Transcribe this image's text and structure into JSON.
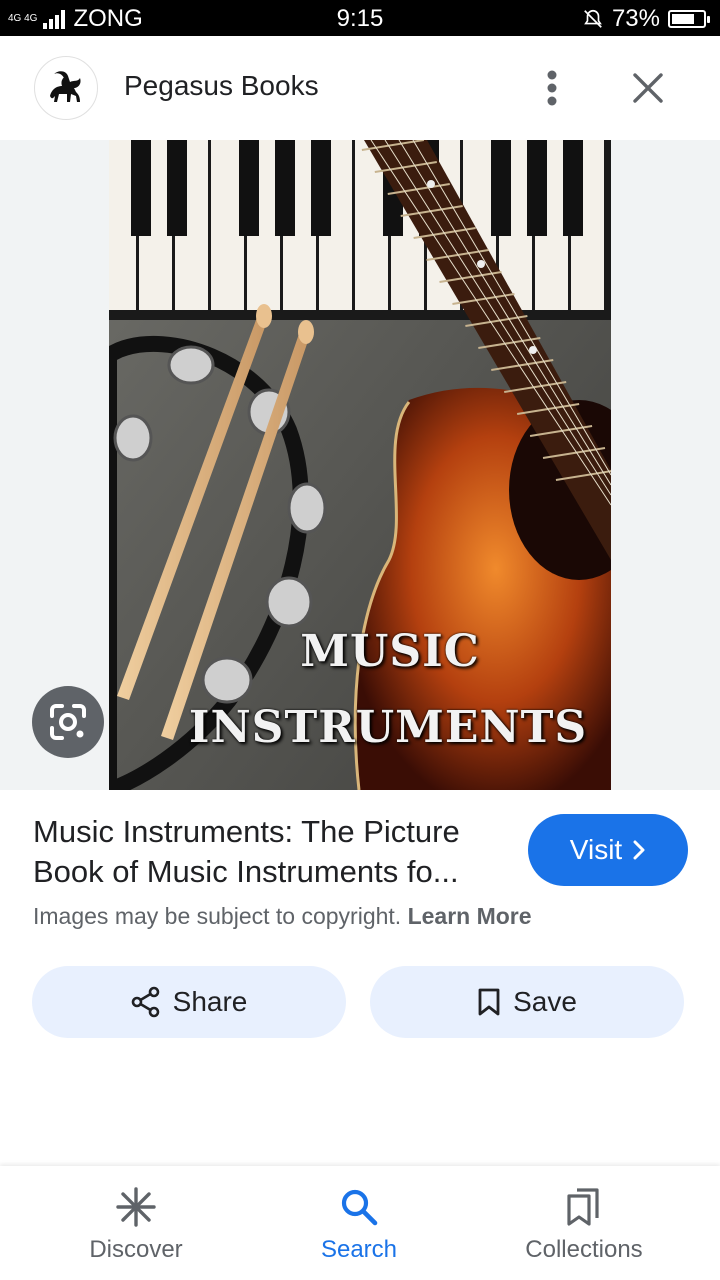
{
  "status_bar": {
    "network": "4G 4G",
    "carrier": "ZONG",
    "time": "9:15",
    "battery": "73%",
    "battery_level": 0.73
  },
  "header": {
    "source_name": "Pegasus Books",
    "logo_icon": "pegasus-logo-icon",
    "more_icon": "more-vert-icon",
    "close_icon": "close-icon"
  },
  "image": {
    "cover_title_line1": "MUSIC",
    "cover_title_line2": "INSTRUMENTS",
    "lens_icon": "google-lens-icon"
  },
  "result": {
    "title": "Music Instruments: The Picture Book of Music Instruments fo...",
    "visit_label": "Visit",
    "copyright_text": "Images may be subject to copyright.",
    "learn_more": "Learn More"
  },
  "actions": {
    "share_label": "Share",
    "save_label": "Save"
  },
  "bottom_nav": {
    "discover": "Discover",
    "search": "Search",
    "collections": "Collections"
  },
  "colors": {
    "accent": "#1a73e8",
    "pill_bg": "#e8f0fe",
    "image_bg": "#f1f3f4"
  }
}
